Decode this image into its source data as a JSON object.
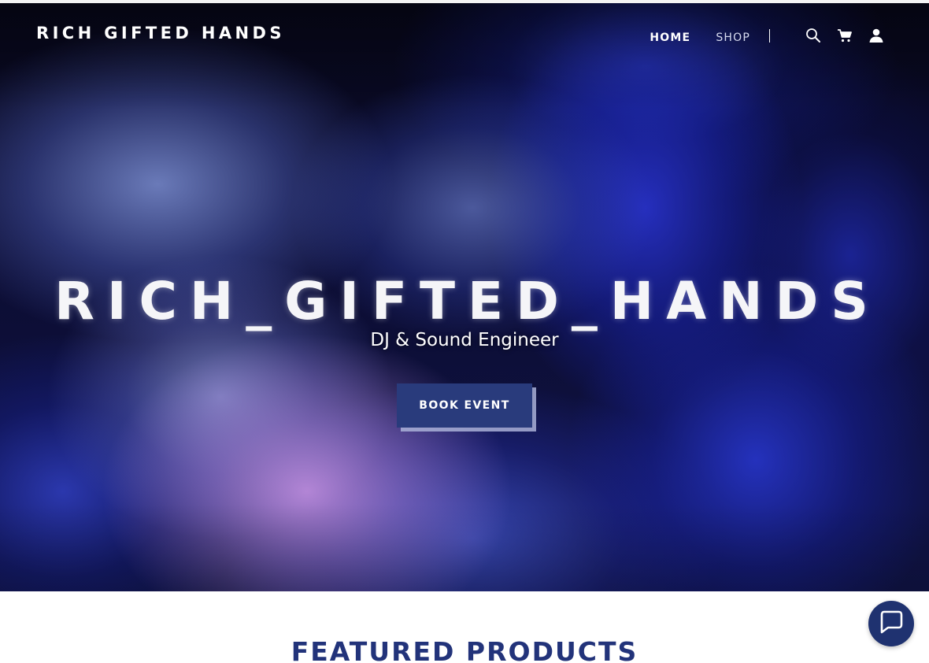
{
  "header": {
    "brand": "RICH GIFTED HANDS",
    "nav": [
      {
        "label": "HOME",
        "active": true
      },
      {
        "label": "SHOP",
        "active": false
      }
    ],
    "icons": [
      "search-icon",
      "cart-icon",
      "account-icon"
    ]
  },
  "hero": {
    "title": "RICH_GIFTED_HANDS",
    "subtitle": "DJ & Sound Engineer",
    "cta_label": "BOOK EVENT"
  },
  "featured": {
    "heading": "FEATURED PRODUCTS"
  },
  "chat": {
    "icon": "chat-icon"
  },
  "colors": {
    "primary": "#293b7c",
    "heading": "#22337a",
    "chat": "#1f3270"
  }
}
